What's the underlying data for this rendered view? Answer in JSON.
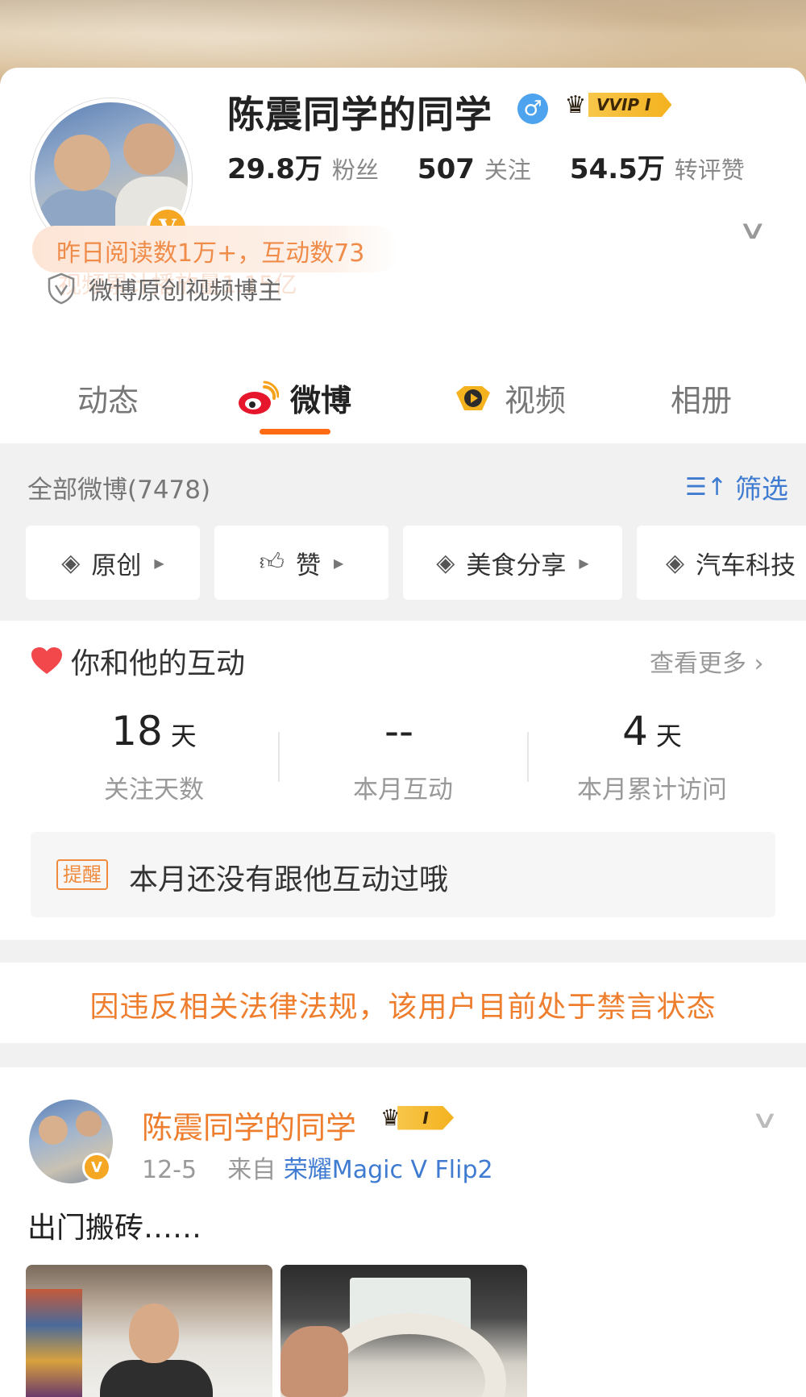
{
  "profile": {
    "name": "陈震同学的同学",
    "gender_symbol": "♂",
    "vip_label": "VVIP I",
    "verify_badge": "V",
    "stats": [
      {
        "num": "29.8万",
        "label": "粉丝"
      },
      {
        "num": "507",
        "label": "关注"
      },
      {
        "num": "54.5万",
        "label": "转评赞"
      }
    ],
    "summary_line1": "昨日阅读数1万+，互动数73",
    "summary_line2": "视频累计播放量1.15亿",
    "certification": "微博原创视频博主"
  },
  "tabs": [
    {
      "label": "动态",
      "icon": "none"
    },
    {
      "label": "微博",
      "icon": "weibo-logo-icon",
      "active": true
    },
    {
      "label": "视频",
      "icon": "video-play-icon"
    },
    {
      "label": "相册",
      "icon": "none"
    }
  ],
  "feed": {
    "all_label": "全部微博(7478)",
    "filter_label": "筛选",
    "chips": [
      {
        "label": "原创",
        "icon": "layers-icon"
      },
      {
        "label": "赞",
        "icon": "thumbs-up-icon"
      },
      {
        "label": "美食分享",
        "icon": "layers-icon"
      },
      {
        "label": "汽车科技",
        "icon": "layers-icon"
      }
    ]
  },
  "interaction": {
    "title": "你和他的互动",
    "more_label": "查看更多",
    "stats": [
      {
        "value": "18",
        "unit": "天",
        "caption": "关注天数"
      },
      {
        "value": "--",
        "unit": "",
        "caption": "本月互动"
      },
      {
        "value": "4",
        "unit": "天",
        "caption": "本月累计访问"
      }
    ],
    "remind_tag": "提醒",
    "remind_text": "本月还没有跟他互动过哦"
  },
  "banned_notice": "因违反相关法律法规，该用户目前处于禁言状态",
  "post": {
    "author": "陈震同学的同学",
    "vip_label": "I",
    "date": "12-5",
    "from_label": "来自",
    "source": "荣耀Magic V Flip2",
    "text": "出门搬砖……"
  },
  "colors": {
    "accent_orange": "#ff6a13",
    "link_blue": "#3f7bd0",
    "notice_orange": "#ee7e2d",
    "vip_gold": "#f4b21f"
  }
}
